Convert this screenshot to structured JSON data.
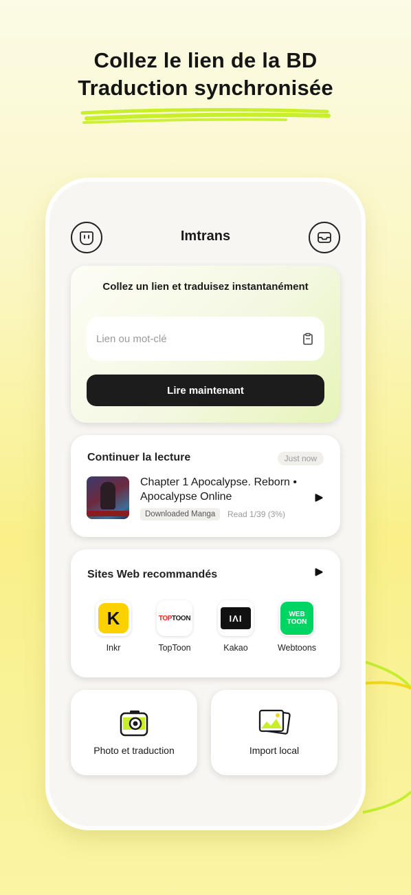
{
  "headline": {
    "line1": "Collez le lien de la BD",
    "line2": "Traduction synchronisée"
  },
  "header": {
    "title": "Imtrans",
    "left_icon": "smiley-face-icon",
    "right_icon": "inbox-tray-icon"
  },
  "paste_card": {
    "title": "Collez un lien et traduisez instantanément",
    "search_placeholder": "Lien ou mot-clé",
    "search_value": "",
    "clipboard_icon": "clipboard-icon",
    "read_button": "Lire maintenant"
  },
  "continue_reading": {
    "title": "Continuer la lecture",
    "badge": "Just now",
    "chapter_title": "Chapter 1 Apocalypse. Reborn • Apocalypse Online",
    "tag": "Downloaded Manga",
    "progress": "Read 1/39 (3%)",
    "play_icon": "play-icon"
  },
  "recommended_sites": {
    "title": "Sites Web recommandés",
    "sites": [
      {
        "label": "Inkr",
        "icon": "inkr-logo-icon"
      },
      {
        "label": "TopToon",
        "icon": "toptoon-logo-icon"
      },
      {
        "label": "Kakao",
        "icon": "kakao-logo-icon"
      },
      {
        "label": "Webtoons",
        "icon": "webtoon-logo-icon"
      }
    ],
    "logo_text": {
      "inkr": "K",
      "toptoon_top": "TOP",
      "toptoon_rest": "TOON",
      "kakao": "IΛI",
      "webtoon_1": "WEB",
      "webtoon_2": "TOON"
    }
  },
  "tools": {
    "photo_label": "Photo et traduction",
    "import_label": "Import local"
  },
  "colors": {
    "accent_green": "#c8ef2a",
    "dark_button": "#1c1c1c",
    "background_yellow": "#f9f08a"
  }
}
